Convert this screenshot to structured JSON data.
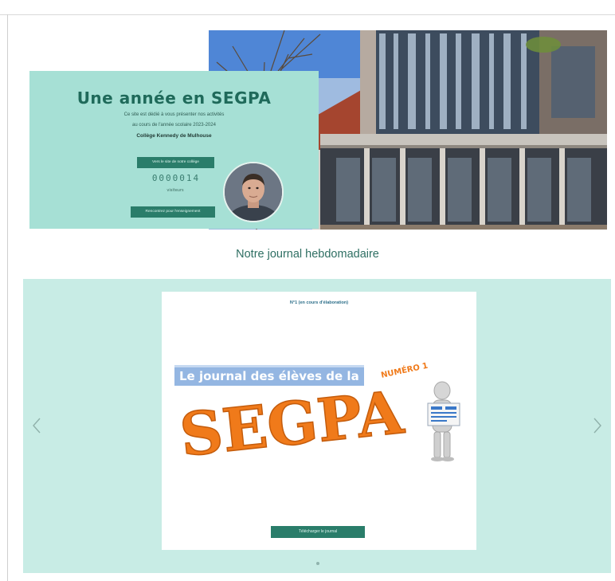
{
  "hero": {
    "title": "Une année en SEGPA",
    "line1": "Ce site est dédié à vous présenter nos activités",
    "line2": "au cours de l'année scolaire 2023-2024",
    "school": "Collège Kennedy de Mulhouse",
    "visit_button": "Vers le site de notre collège",
    "visitor_count": "0000014",
    "visitor_label": "visiteurs",
    "reach_button": "Rencontrez pour l'enseignement"
  },
  "section": {
    "title": "Notre journal hebdomadaire"
  },
  "carousel": {
    "slide_caption": "N°1 (en cours d'élaboration)",
    "cover_banner": "Le journal des élèves de la",
    "cover_word": "SEGPA",
    "cover_issue": "NUMÉRO 1",
    "download_button": "Télécharger le journal"
  },
  "colors": {
    "accent": "#2a7d6a",
    "mint_card": "#a6e0d5",
    "mint_band": "#c8ece5",
    "title_green": "#1f6a5a",
    "cover_orange": "#f07a1a"
  }
}
